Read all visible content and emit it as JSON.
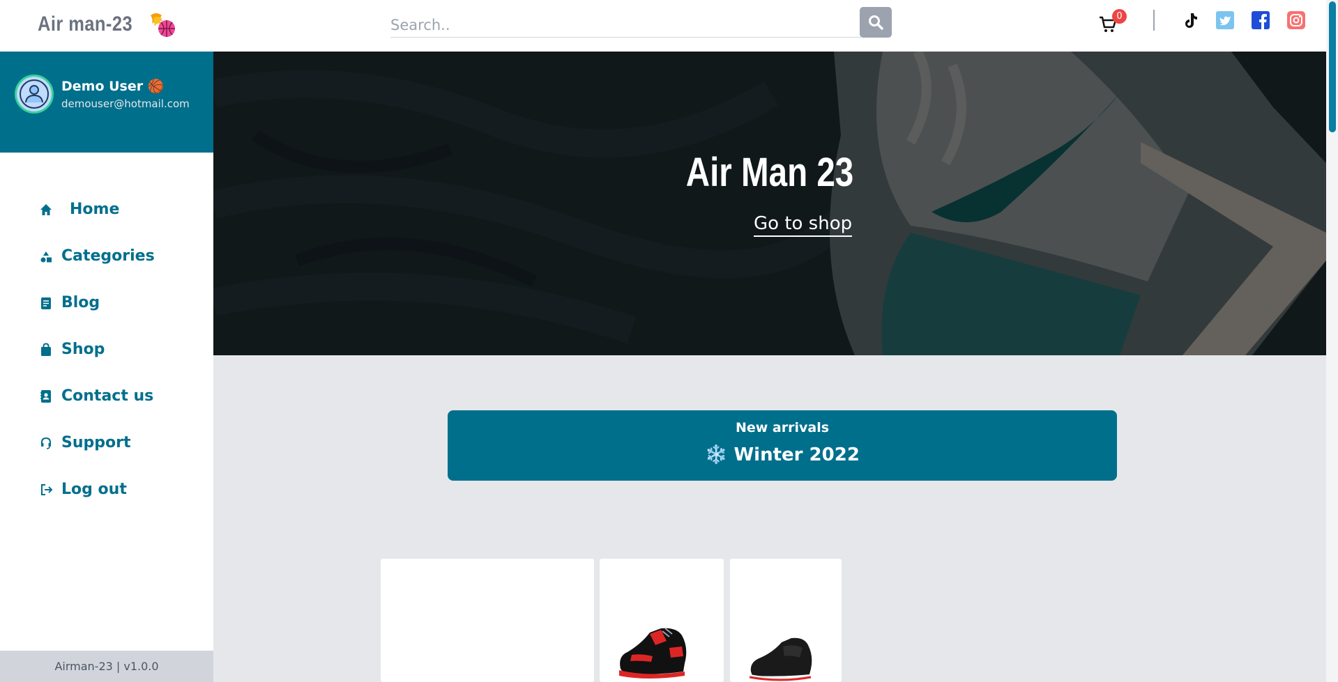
{
  "topbar": {
    "brand": "Air man-23",
    "search_placeholder": "Search..",
    "cart_count": "0",
    "social": [
      "tiktok-icon",
      "twitter-icon",
      "facebook-icon",
      "instagram-icon"
    ]
  },
  "sidebar": {
    "user_name": "Demo User 🏀",
    "user_email": "demouser@hotmail.com",
    "items": [
      {
        "label": "Home",
        "icon": "home-icon"
      },
      {
        "label": "Categories",
        "icon": "categories-icon"
      },
      {
        "label": "Blog",
        "icon": "blog-icon"
      },
      {
        "label": "Shop",
        "icon": "shop-bag-icon"
      },
      {
        "label": "Contact us",
        "icon": "contact-icon"
      },
      {
        "label": "Support",
        "icon": "support-icon"
      },
      {
        "label": "Log out",
        "icon": "logout-icon"
      }
    ],
    "version": "Airman-23 | v1.0.0"
  },
  "hero": {
    "title": "Air Man 23",
    "link": "Go to shop"
  },
  "arrivals": {
    "subtitle": "New arrivals",
    "title": "❄️ Winter 2022"
  },
  "colors": {
    "primary": "#006f8c",
    "badge": "#ef4444",
    "background": "#e5e7eb"
  }
}
